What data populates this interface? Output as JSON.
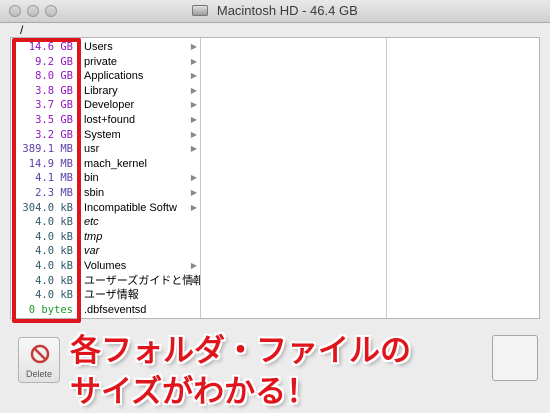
{
  "window": {
    "title": "Macintosh HD - 46.4 GB",
    "path": "/"
  },
  "colors": {
    "accent": "#e0151b",
    "size_purple": "#8a1ab6",
    "size_blue": "#2e3a8f",
    "size_gray": "#555555",
    "size_green": "#1a8a1a"
  },
  "rows": [
    {
      "size": "14.6 GB",
      "name": "Users",
      "arrow": true,
      "italic": false,
      "color": "#9516c4"
    },
    {
      "size": "9.2 GB",
      "name": "private",
      "arrow": true,
      "italic": false,
      "color": "#9516c4"
    },
    {
      "size": "8.0 GB",
      "name": "Applications",
      "arrow": true,
      "italic": false,
      "color": "#9516c4"
    },
    {
      "size": "3.8 GB",
      "name": "Library",
      "arrow": true,
      "italic": false,
      "color": "#9516c4"
    },
    {
      "size": "3.7 GB",
      "name": "Developer",
      "arrow": true,
      "italic": false,
      "color": "#9516c4"
    },
    {
      "size": "3.5 GB",
      "name": "lost+found",
      "arrow": true,
      "italic": false,
      "color": "#9516c4"
    },
    {
      "size": "3.2 GB",
      "name": "System",
      "arrow": true,
      "italic": false,
      "color": "#9516c4"
    },
    {
      "size": "389.1 MB",
      "name": "usr",
      "arrow": true,
      "italic": false,
      "color": "#5b3fa6"
    },
    {
      "size": "14.9 MB",
      "name": "mach_kernel",
      "arrow": false,
      "italic": false,
      "color": "#5b3fa6"
    },
    {
      "size": "4.1 MB",
      "name": "bin",
      "arrow": true,
      "italic": false,
      "color": "#5b3fa6"
    },
    {
      "size": "2.3 MB",
      "name": "sbin",
      "arrow": true,
      "italic": false,
      "color": "#5b3fa6"
    },
    {
      "size": "304.0 kB",
      "name": "Incompatible Softw",
      "arrow": true,
      "italic": false,
      "color": "#2f5a6b"
    },
    {
      "size": "4.0 kB",
      "name": "etc",
      "arrow": false,
      "italic": true,
      "color": "#2f5a6b"
    },
    {
      "size": "4.0 kB",
      "name": "tmp",
      "arrow": false,
      "italic": true,
      "color": "#2f5a6b"
    },
    {
      "size": "4.0 kB",
      "name": "var",
      "arrow": false,
      "italic": true,
      "color": "#2f5a6b"
    },
    {
      "size": "4.0 kB",
      "name": "Volumes",
      "arrow": true,
      "italic": false,
      "color": "#2f5a6b"
    },
    {
      "size": "4.0 kB",
      "name": "ユーザーズガイドと情報",
      "arrow": true,
      "italic": false,
      "color": "#2f5a6b"
    },
    {
      "size": "4.0 kB",
      "name": "ユーザ情報",
      "arrow": false,
      "italic": false,
      "color": "#2f5a6b"
    },
    {
      "size": "0 bytes",
      "name": ".dbfseventsd",
      "arrow": false,
      "italic": false,
      "color": "#1f9a2a"
    }
  ],
  "toolbar": {
    "delete_label": "Delete"
  },
  "annotation": {
    "line1": "各フォルダ・ファイルの",
    "line2": "サイズがわかる！"
  }
}
